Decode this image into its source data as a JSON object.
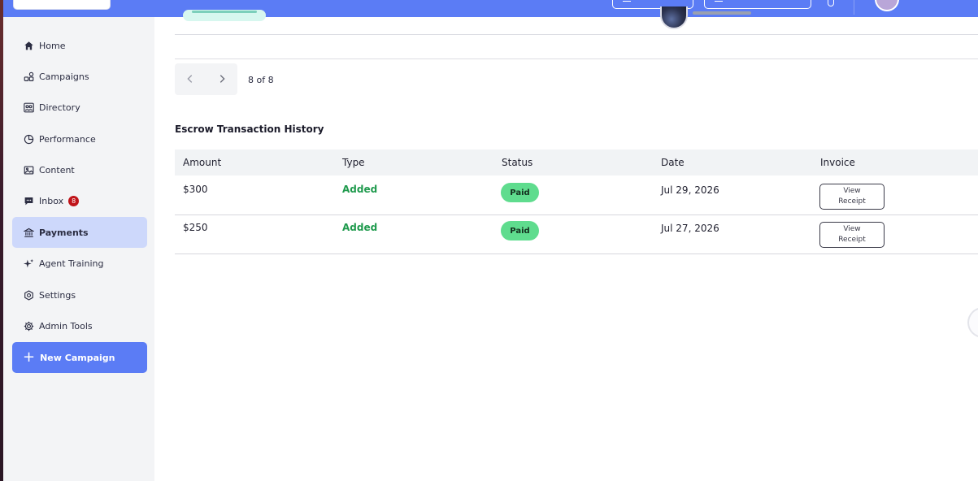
{
  "sidebar": {
    "items": [
      {
        "label": "Home",
        "icon": "home-icon"
      },
      {
        "label": "Campaigns",
        "icon": "campaigns-icon"
      },
      {
        "label": "Directory",
        "icon": "directory-icon"
      },
      {
        "label": "Performance",
        "icon": "pie-chart-icon"
      },
      {
        "label": "Content",
        "icon": "image-icon"
      },
      {
        "label": "Inbox",
        "icon": "chat-icon",
        "badge": "8"
      },
      {
        "label": "Payments",
        "icon": "bank-icon",
        "active": true
      },
      {
        "label": "Agent Training",
        "icon": "sparkle-icon"
      },
      {
        "label": "Settings",
        "icon": "gear-icon"
      },
      {
        "label": "Admin Tools",
        "icon": "admin-gear-icon"
      }
    ],
    "new_campaign_label": "New Campaign"
  },
  "pagination": {
    "label": "8 of 8"
  },
  "escrow": {
    "title": "Escrow Transaction History",
    "columns": [
      "Amount",
      "Type",
      "Status",
      "Date",
      "Invoice"
    ],
    "rows": [
      {
        "amount": "$300",
        "type": "Added",
        "status": "Paid",
        "date": "Jul 29, 2026",
        "invoice_label": "View\nReceipt"
      },
      {
        "amount": "$250",
        "type": "Added",
        "status": "Paid",
        "date": "Jul 27, 2026",
        "invoice_label": "View\nReceipt"
      }
    ]
  },
  "colors": {
    "accent": "#5b7cf5",
    "active_nav": "#cdd8fb",
    "paid": "#5fdc8e",
    "added": "#1f9a4d",
    "badge": "#c0141a"
  }
}
